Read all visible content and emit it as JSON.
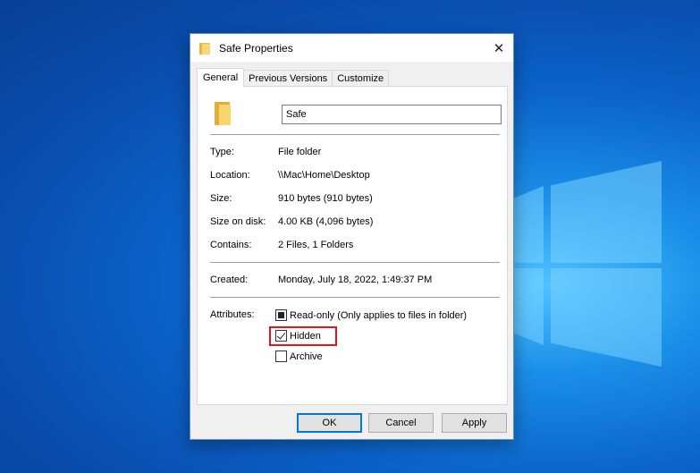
{
  "dialog": {
    "title": "Safe Properties",
    "close_glyph": "✕",
    "tabs": [
      {
        "label": "General",
        "active": true
      },
      {
        "label": "Previous Versions",
        "active": false
      },
      {
        "label": "Customize",
        "active": false
      }
    ],
    "name_value": "Safe",
    "details": {
      "type_label": "Type:",
      "type_value": "File folder",
      "location_label": "Location:",
      "location_value": "\\\\Mac\\Home\\Desktop",
      "size_label": "Size:",
      "size_value": "910 bytes (910 bytes)",
      "size_on_disk_label": "Size on disk:",
      "size_on_disk_value": "4.00 KB (4,096 bytes)",
      "contains_label": "Contains:",
      "contains_value": "2 Files, 1 Folders",
      "created_label": "Created:",
      "created_value": "Monday, July 18, 2022, 1:49:37 PM"
    },
    "attributes": {
      "label": "Attributes:",
      "readonly": {
        "label": "Read-only (Only applies to files in folder)",
        "state": "indeterminate"
      },
      "hidden": {
        "label": "Hidden",
        "state": "checked"
      },
      "archive": {
        "label": "Archive",
        "state": "unchecked"
      }
    },
    "buttons": {
      "ok": "OK",
      "cancel": "Cancel",
      "apply": "Apply"
    }
  },
  "colors": {
    "highlight": "#e0161f",
    "default_button_border": "#0078d7",
    "folder": "#fbd56d"
  },
  "icons": [
    "folder-icon",
    "close-icon",
    "windows-logo"
  ]
}
